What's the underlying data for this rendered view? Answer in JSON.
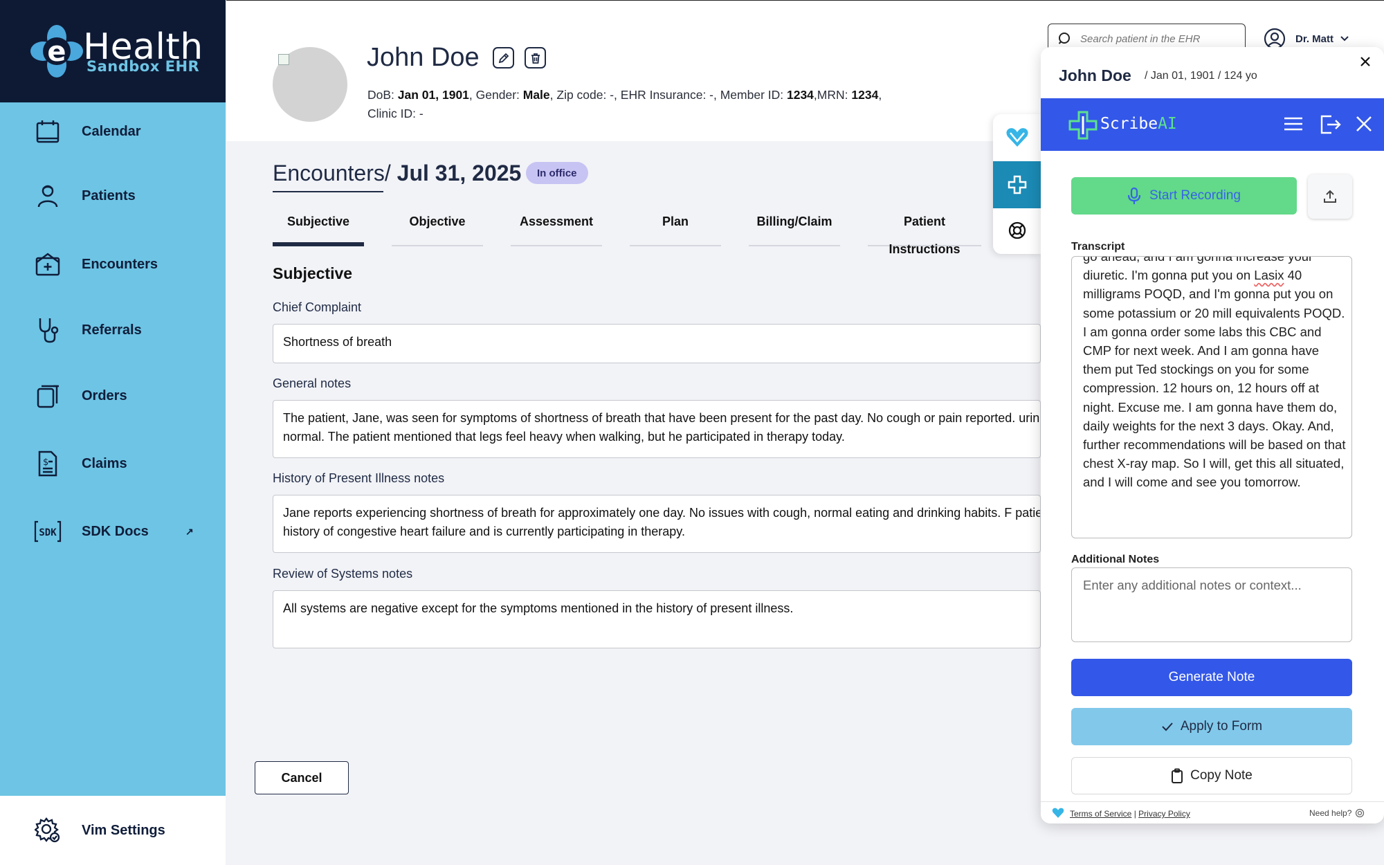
{
  "brand": {
    "name": "Health",
    "sub": "Sandbox EHR",
    "colors": {
      "primary": "#6ec4e4",
      "dark": "#0e1a34"
    }
  },
  "sidebar": {
    "items": [
      {
        "label": "Calendar",
        "icon": "calendar-icon"
      },
      {
        "label": "Patients",
        "icon": "patient-icon"
      },
      {
        "label": "Encounters",
        "icon": "medical-bag-icon"
      },
      {
        "label": "Referrals",
        "icon": "stethoscope-icon"
      },
      {
        "label": "Orders",
        "icon": "orders-icon"
      },
      {
        "label": "Claims",
        "icon": "claims-document-icon"
      },
      {
        "label": "SDK Docs",
        "icon": "sdk-icon",
        "external": "↗"
      }
    ],
    "settings": {
      "label": "Vim Settings",
      "icon": "gear-icon"
    }
  },
  "header": {
    "patient_name": "John Doe",
    "info": {
      "dob_label": "DoB: ",
      "dob": "Jan 01, 1901",
      "gender_label": ", Gender: ",
      "gender": "Male",
      "rest1": ", Zip code: -, EHR Insurance: -, Member ID: ",
      "member_id": "1234",
      "mrn_label": ",MRN: ",
      "mrn": "1234",
      "clinic": ", Clinic ID: -"
    },
    "search": {
      "placeholder": "Search patient in the EHR"
    },
    "user": {
      "name": "Dr. Matt"
    }
  },
  "encounter": {
    "title_prefix": "Encounters/",
    "date": "Jul 31, 2025",
    "status": "In office",
    "tabs": [
      "Subjective",
      "Objective",
      "Assessment",
      "Plan",
      "Billing/Claim",
      "Patient Instructions"
    ],
    "active_tab": "Subjective",
    "section_title": "Subjective",
    "fields": {
      "chief_complaint": {
        "label": "Chief Complaint",
        "value": "Shortness of breath"
      },
      "general_notes": {
        "label": "General notes",
        "value": "The patient, Jane, was seen for symptoms of shortness of breath that have been present for the past day. No cough or pain reported. urination are normal. The patient mentioned that legs feel heavy when walking, but he participated in therapy today."
      },
      "hpi": {
        "label": "History of Present Illness notes",
        "value": "Jane reports experiencing shortness of breath for approximately one day. No issues with cough, normal eating and drinking habits. F patient has a history of congestive heart failure and is currently participating in therapy."
      },
      "ros": {
        "label": "Review of Systems notes",
        "value": "All systems are negative except for the symptoms mentioned in the history of present illness."
      }
    },
    "cancel_label": "Cancel"
  },
  "panel": {
    "patient_name": "John Doe",
    "meta": "/ Jan 01, 1901 / 124 yo",
    "scribe": {
      "name": "Scribe",
      "suffix": "AI",
      "colors": {
        "bar": "#3357e8",
        "accent": "#5ee08e"
      }
    },
    "start_recording": "Start Recording",
    "transcript_label": "Transcript",
    "transcript_pre": "go ahead, and I am gonna increase your diuretic. I'm gonna put you on ",
    "transcript_lasix": "Lasix",
    "transcript_post": " 40 milligrams POQD, and I'm gonna put you on some potassium or 20 mill equivalents POQD. I am gonna order some labs this CBC and CMP for next week. And I am gonna have them put Ted stockings on you for some compression. 12 hours on, 12 hours off at night. Excuse me. I am gonna have them do, daily weights for the next 3 days. Okay. And, further recommendations will be based on that chest X-ray map. So I will, get this all situated, and I will come and see you tomorrow.",
    "additional_label": "Additional Notes",
    "additional_placeholder": "Enter any additional notes or context...",
    "generate": "Generate Note",
    "apply": "Apply to Form",
    "copy": "Copy Note",
    "footer": {
      "terms": "Terms of Service",
      "sep": " | ",
      "privacy": "Privacy Policy",
      "help": "Need help?"
    }
  }
}
